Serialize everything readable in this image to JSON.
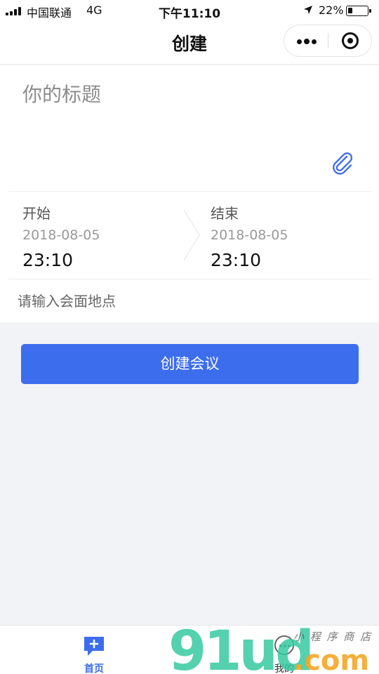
{
  "status_bar": {
    "carrier": "中国联通",
    "network": "4G",
    "time": "下午11:10",
    "battery": "22%",
    "battery_level": 0.22
  },
  "nav": {
    "title": "创建"
  },
  "form": {
    "title_placeholder": "你的标题",
    "start": {
      "label": "开始",
      "date": "2018-08-05",
      "time": "23:10"
    },
    "end": {
      "label": "结束",
      "date": "2018-08-05",
      "time": "23:10"
    },
    "location_placeholder": "请输入会面地点"
  },
  "actions": {
    "create_label": "创建会议"
  },
  "tab_bar": {
    "home_label": "首页",
    "mine_label": "我的"
  },
  "icons": {
    "attach": "paperclip-icon",
    "home": "chat-plus-icon",
    "mine": "chat-dots-icon"
  },
  "colors": {
    "accent": "#3c6ded",
    "background": "#f2f3f7"
  },
  "watermark": {
    "brand": "91ud",
    "suffix": ".com",
    "caption": "小 程 序 商 店"
  }
}
